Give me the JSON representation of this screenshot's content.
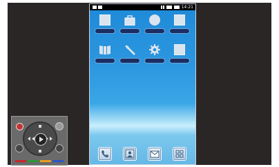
{
  "status_bar": {
    "time": "14:21"
  },
  "home_apps": [
    {
      "name": "app-1-icon"
    },
    {
      "name": "store-icon"
    },
    {
      "name": "circle-app-icon"
    },
    {
      "name": "app-4-icon"
    },
    {
      "name": "book-icon"
    },
    {
      "name": "wrench-icon"
    },
    {
      "name": "settings-gear-icon"
    },
    {
      "name": "app-8-icon"
    }
  ],
  "dock": [
    {
      "name": "phone-icon"
    },
    {
      "name": "contacts-icon"
    },
    {
      "name": "mail-icon"
    },
    {
      "name": "apps-grid-icon"
    }
  ],
  "remote": {
    "colors": {
      "red": "#c8262b",
      "green": "#2a9a3a",
      "orange": "#e8a020",
      "blue": "#2b56c8"
    }
  }
}
